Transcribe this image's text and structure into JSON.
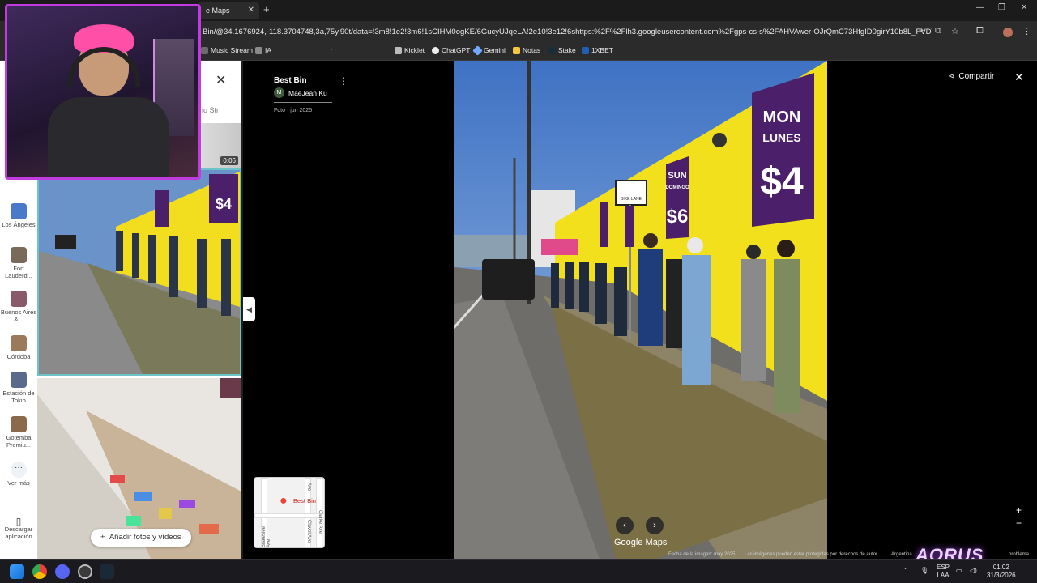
{
  "browser": {
    "tab_title": "e Maps",
    "url": "Bin/@34.1676924,-118.3704748,3a,75y,90t/data=!3m8!1e2!3m6!1sCIHM0ogKE/6GucyUJqeLA!2e10!3e12!6shttps:%2F%2Flh3.googleusercontent.com%2Fgps-cs-s%2FAHVAwer-OJrQmC73HfgID0girY10b8L_FVDVeAfZqkOjZjGfD...",
    "bookmarks": [
      "Music Stream",
      "IA",
      "Kicklet",
      "ChatGPT",
      "Gemini",
      "Notas",
      "Stake",
      "1XBET"
    ]
  },
  "rail": {
    "items": [
      {
        "label": "Los Ángeles",
        "color": "#4a79c9"
      },
      {
        "label": "Fort Lauderd...",
        "color": "#7a6a5a"
      },
      {
        "label": "Buenos Aires &...",
        "color": "#8a5a6a"
      },
      {
        "label": "Córdoba",
        "color": "#9a7a5a"
      },
      {
        "label": "Estación de Tokio",
        "color": "#5a6a8a"
      },
      {
        "label": "Gotemba Premiu...",
        "color": "#8a6a4a"
      }
    ],
    "more_label": "Ver más",
    "download_label": "Descargar aplicación"
  },
  "panel": {
    "tabs_text": "rio   Str",
    "video_duration": "0:06",
    "add_photos_label": "Añadir fotos y vídeos"
  },
  "viewer": {
    "place_name": "Best Bin",
    "author_initial": "M",
    "author_name": "MaeJean Ku",
    "photo_date": "Foto · jun 2025",
    "share_label": "Compartir",
    "minimap_label": "Best Bin",
    "minimap_streets": [
      "Blakeslee Ave",
      "Clavel Ave",
      "Clarke Ave",
      "Ave"
    ],
    "logo": "Google Maps",
    "footer_date": "Fecha de la imagen: may 2025",
    "footer_copyright": "Las imágenes pueden estar protegidas por derechos de autor.",
    "footer_country": "Argentina",
    "footer_report": "problema"
  },
  "photo_signs": {
    "mon": "MON",
    "lunes": "LUNES",
    "price_mon": "$4",
    "sun": "SUN",
    "domingo": "DOMINGO",
    "price_sun": "$6",
    "bike": "BIKE LANE",
    "wall_color": "#f5e21a",
    "sign_color": "#4b1f6a"
  },
  "taskbar": {
    "lang": "ESP",
    "lang2": "LAA",
    "time": "01:02",
    "date": "31/3/2026",
    "brand": "AORUS"
  }
}
